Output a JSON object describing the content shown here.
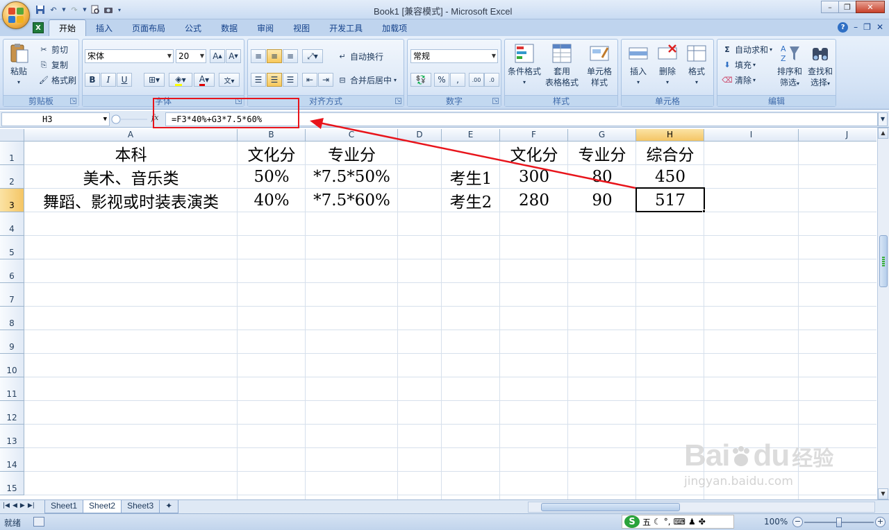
{
  "window": {
    "title": "Book1  [兼容模式] - Microsoft Excel"
  },
  "tabs": [
    "开始",
    "插入",
    "页面布局",
    "公式",
    "数据",
    "审阅",
    "视图",
    "开发工具",
    "加载项"
  ],
  "ribbon": {
    "clipboard": {
      "label": "剪贴板",
      "paste": "粘贴",
      "cut": "剪切",
      "copy": "复制",
      "format_painter": "格式刷"
    },
    "font": {
      "label": "字体",
      "name": "宋体",
      "size": "20"
    },
    "alignment": {
      "label": "对齐方式",
      "wrap": "自动换行",
      "merge": "合并后居中"
    },
    "number": {
      "label": "数字",
      "format": "常规"
    },
    "styles": {
      "label": "样式",
      "cond": "条件格式",
      "table1": "套用",
      "table2": "表格格式",
      "cell1": "单元格",
      "cell2": "样式"
    },
    "cells": {
      "label": "单元格",
      "insert": "插入",
      "delete": "删除",
      "format": "格式"
    },
    "editing": {
      "label": "编辑",
      "autosum": "自动求和",
      "fill": "填充",
      "clear": "清除",
      "sort1": "排序和",
      "sort2": "筛选",
      "find1": "查找和",
      "find2": "选择"
    }
  },
  "formula_bar": {
    "name_box": "H3",
    "formula": "=F3*40%+G3*7.5*60%"
  },
  "columns": [
    "A",
    "B",
    "C",
    "D",
    "E",
    "F",
    "G",
    "H",
    "I",
    "J"
  ],
  "rows": [
    "1",
    "2",
    "3",
    "4",
    "5",
    "6",
    "7",
    "8",
    "9",
    "10",
    "11",
    "12",
    "13",
    "14",
    "15"
  ],
  "cells": {
    "A1": "本科",
    "B1": "文化分",
    "C1": "专业分",
    "F1": "文化分",
    "G1": "专业分",
    "H1": "综合分",
    "A2": "美术、音乐类",
    "B2": "50%",
    "C2": "*7.5*50%",
    "E2": "考生1",
    "F2": "300",
    "G2": "80",
    "H2": "450",
    "A3": "舞蹈、影视或时装表演类",
    "B3": "40%",
    "C3": "*7.5*60%",
    "E3": "考生2",
    "F3": "280",
    "G3": "90",
    "H3": "517"
  },
  "sheets": [
    "Sheet1",
    "Sheet2",
    "Sheet3"
  ],
  "active_sheet": "Sheet2",
  "status": {
    "ready": "就绪",
    "zoom": "100%",
    "ime": "五"
  },
  "watermark": {
    "brand": "Bai",
    "brand2": "du",
    "cn": "经验",
    "url": "jingyan.baidu.com"
  },
  "colors": {
    "annotation": "#e8141b",
    "selected_header": "#f4c565"
  }
}
